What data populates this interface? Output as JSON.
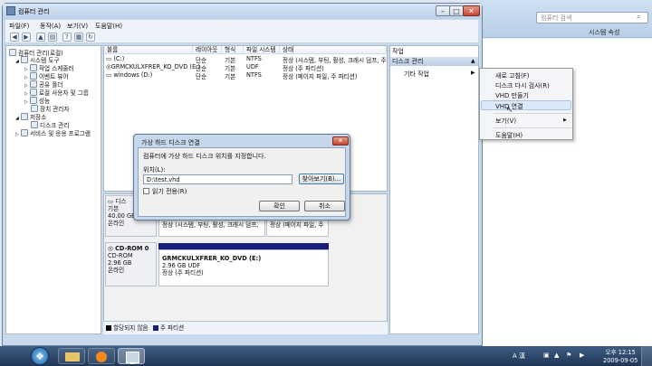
{
  "window": {
    "title": "컴퓨터 관리"
  },
  "menu": [
    "파일(F)",
    "동작(A)",
    "보기(V)",
    "도움말(H)"
  ],
  "toolbar": [
    "back-icon",
    "forward-icon",
    "up-icon",
    "show-hide-tree-icon",
    "help-icon",
    "properties-icon",
    "refresh-icon"
  ],
  "tree": {
    "items": [
      {
        "label": "컴퓨터 관리(로컬)",
        "depth": 0,
        "icon": "computer-icon"
      },
      {
        "label": "시스템 도구",
        "depth": 1,
        "icon": "tools-icon"
      },
      {
        "label": "작업 스케줄러",
        "depth": 2,
        "icon": "clock-icon"
      },
      {
        "label": "이벤트 뷰어",
        "depth": 2,
        "icon": "event-icon"
      },
      {
        "label": "공유 폴더",
        "depth": 2,
        "icon": "folder-icon"
      },
      {
        "label": "로컬 사용자 및 그룹",
        "depth": 2,
        "icon": "users-icon"
      },
      {
        "label": "성능",
        "depth": 2,
        "icon": "performance-icon"
      },
      {
        "label": "장치 관리자",
        "depth": 2,
        "icon": "device-icon"
      },
      {
        "label": "저장소",
        "depth": 1,
        "icon": "storage-icon"
      },
      {
        "label": "디스크 관리",
        "depth": 2,
        "icon": "disk-icon"
      },
      {
        "label": "서비스 및 응용 프로그램",
        "depth": 1,
        "icon": "services-icon"
      }
    ]
  },
  "volumes": {
    "headers": [
      "볼륨",
      "레이아웃",
      "형식",
      "파일 시스템",
      "상태"
    ],
    "rows": [
      [
        "(C:)",
        "단순",
        "기본",
        "NTFS",
        "정상 (시스템, 부팅, 활성, 크래시 덤프, 주"
      ],
      [
        "GRMCKULXFRER_KO_DVD (E:)",
        "단순",
        "기본",
        "UDF",
        "정상 (주 파티션)"
      ],
      [
        "windows (D:)",
        "단순",
        "기본",
        "NTFS",
        "정상 (페이지 파일, 주 파티션)"
      ]
    ]
  },
  "disks": [
    {
      "name": "디스",
      "type": "기본",
      "size": "40.00 GB",
      "status": "온라인",
      "parts": [
        {
          "status": "정상 (시스템, 부팅, 활성, 크래시 덤프,"
        },
        {
          "status": "정상 (페이지 파일, 주 파티션)"
        }
      ]
    },
    {
      "name": "CD-ROM 0",
      "type": "CD-ROM",
      "size": "2.96 GB",
      "status": "온라인",
      "parts": [
        {
          "name": "GRMCKULXFRER_KO_DVD  (E:)",
          "size": "2.96 GB UDF",
          "status": "정상 (주 파티션)"
        }
      ]
    }
  ],
  "legend": [
    "할당되지 않음",
    "주 파티션"
  ],
  "actions": {
    "header": "작업",
    "selected": "디스크 관리",
    "more": "기타 작업"
  },
  "context_menu": {
    "items": [
      "새로 고침(F)",
      "디스크 다시 검사(R)",
      "VHD 만들기",
      "VHD 연결",
      "보기(V)",
      "도움말(H)"
    ],
    "highlighted": "VHD 연결"
  },
  "dialog": {
    "title": "가상 하드 디스크 연결",
    "description": "컴퓨터에 가상 하드 디스크 위치를 지정합니다.",
    "location_label": "위치(L):",
    "location_value": "D:\\test.vhd",
    "browse": "찾아보기(B)...",
    "readonly": "읽기 전용(R)",
    "ok": "확인",
    "cancel": "취소"
  },
  "background_window": {
    "search_placeholder": "컴퓨터 검색",
    "command": "시스템 속성"
  },
  "taskbar": {
    "apps": [
      "explorer-icon",
      "media-player-icon",
      "media-center-icon",
      "computer-management-icon"
    ],
    "tray": {
      "ime": "A 漢",
      "time": "오후 12:15",
      "date": "2009-09-05"
    }
  },
  "colors": {
    "primary_partition": "#191e7a",
    "unallocated": "#000000"
  }
}
